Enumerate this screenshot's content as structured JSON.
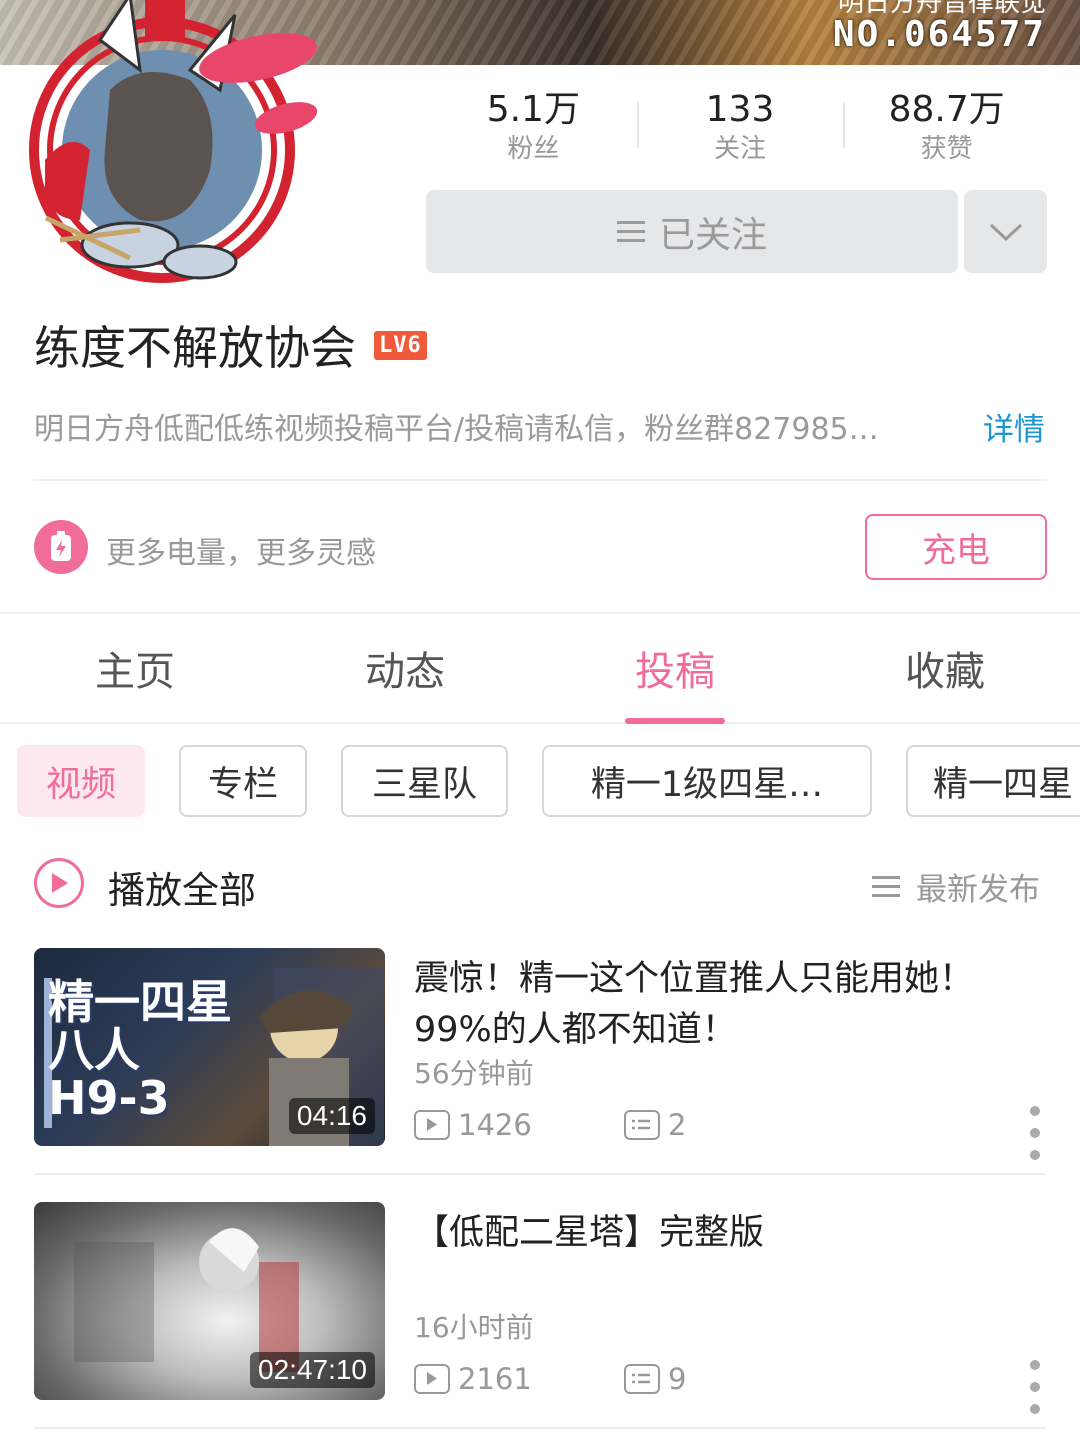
{
  "banner": {
    "top_text": "明日方舟音律联觉",
    "number": "NO.064577"
  },
  "stats": [
    {
      "value": "5.1万",
      "label": "粉丝"
    },
    {
      "value": "133",
      "label": "关注"
    },
    {
      "value": "88.7万",
      "label": "获赞"
    }
  ],
  "follow_button": {
    "label": "已关注"
  },
  "profile": {
    "name": "练度不解放协会",
    "level_badge": "LV6",
    "bio": "明日方舟低配低练视频投稿平台/投稿请私信，粉丝群827985…",
    "detail_link": "详情"
  },
  "charge": {
    "text": "更多电量，更多灵感",
    "button": "充电"
  },
  "tabs": [
    {
      "label": "主页",
      "active": false
    },
    {
      "label": "动态",
      "active": false
    },
    {
      "label": "投稿",
      "active": true
    },
    {
      "label": "收藏",
      "active": false
    }
  ],
  "filters": [
    {
      "label": "视频",
      "active": true
    },
    {
      "label": "专栏",
      "active": false
    },
    {
      "label": "三星队",
      "active": false
    },
    {
      "label": "精一1级四星…",
      "active": false
    },
    {
      "label": "精一四星",
      "active": false
    }
  ],
  "play_all": {
    "label": "播放全部"
  },
  "sort": {
    "label": "最新发布"
  },
  "videos": [
    {
      "thumb_text_1": "精一四星",
      "thumb_text_2": "八人",
      "thumb_text_3": "H9-3",
      "duration": "04:16",
      "title": "震惊！精一这个位置推人只能用她！99%的人都不知道！",
      "time": "56分钟前",
      "plays": "1426",
      "comments": "2"
    },
    {
      "duration": "02:47:10",
      "title": "【低配二星塔】完整版",
      "time": "16小时前",
      "plays": "2161",
      "comments": "9"
    }
  ],
  "colors": {
    "accent": "#f06d98",
    "link": "#1b96d1",
    "level_badge": "#f05a3a"
  }
}
